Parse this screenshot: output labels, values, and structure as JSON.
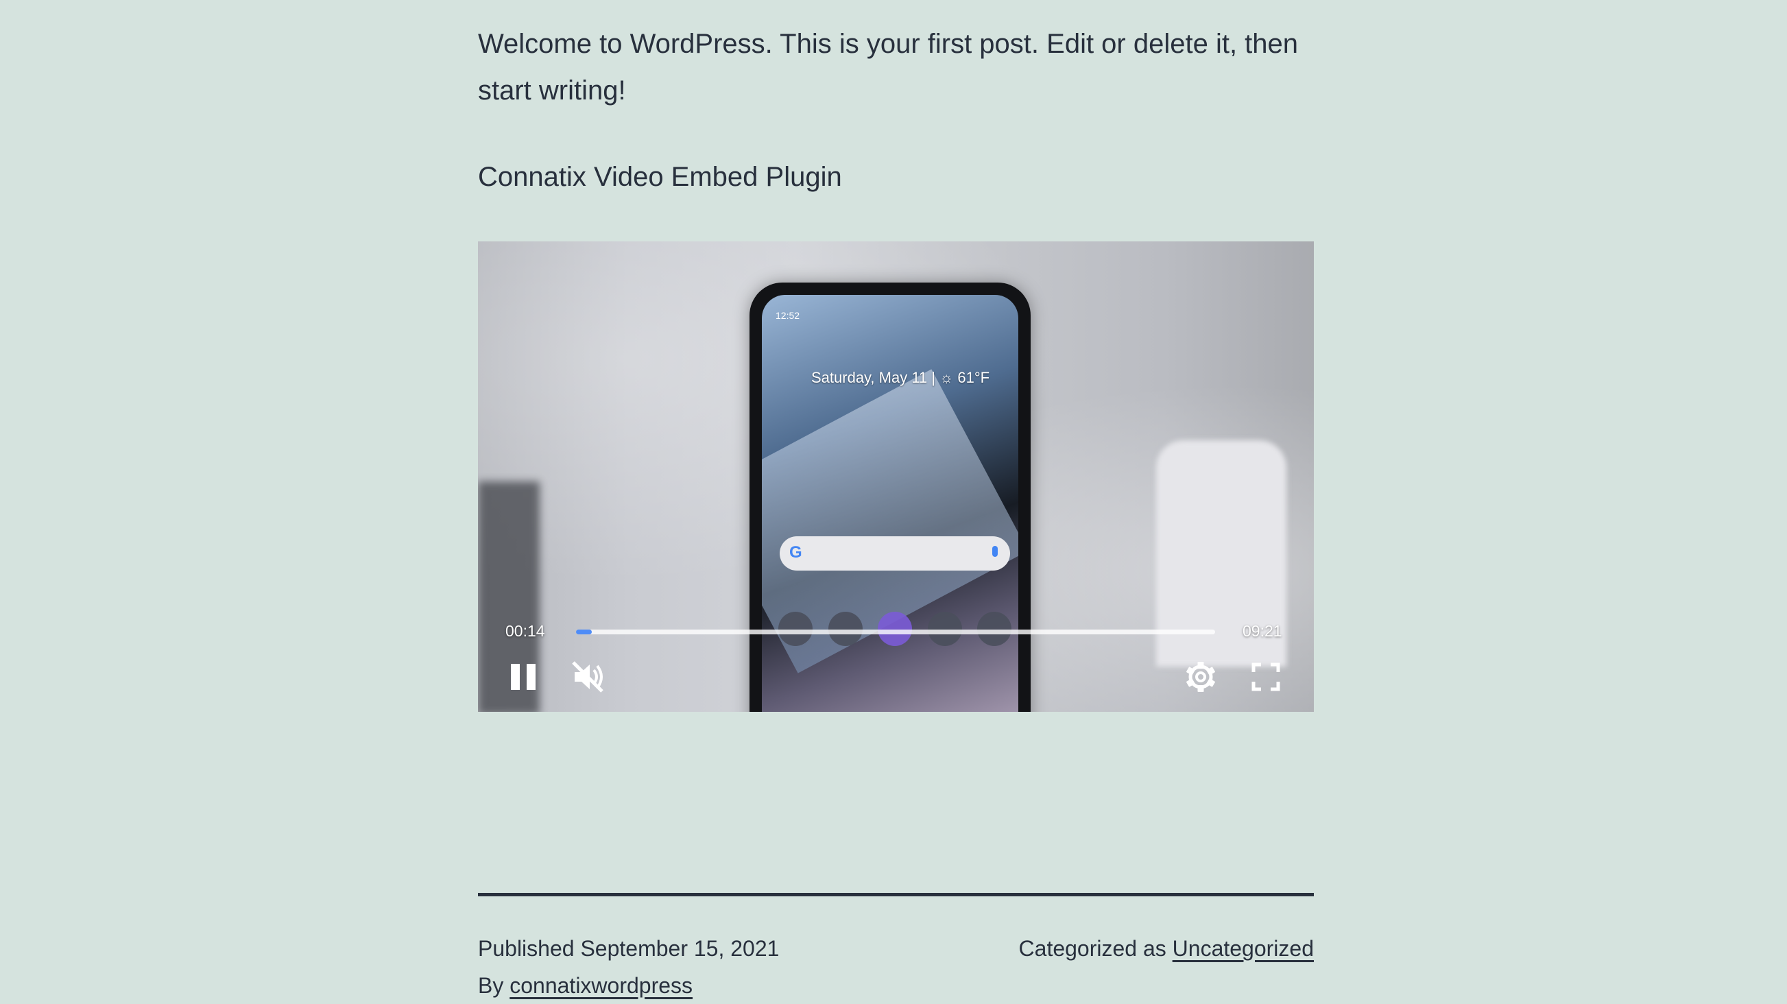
{
  "post": {
    "intro": "Welcome to WordPress. This is your first post. Edit or delete it, then start writing!",
    "plugin_title": "Connatix Video Embed Plugin"
  },
  "video": {
    "current_time": "00:14",
    "duration": "09:21",
    "progress_fraction": 0.025,
    "state": "playing",
    "muted": true,
    "screen_clock": "12:52",
    "screen_date": "Saturday, May 11 | ☼ 61°F",
    "search_logo": "G",
    "icons": [
      "pause-icon",
      "muted-speaker-icon",
      "gear-icon",
      "fullscreen-icon"
    ]
  },
  "footer": {
    "published_prefix": "Published",
    "published_date": "September 15, 2021",
    "categorized_prefix": "Categorized as",
    "category": "Uncategorized",
    "by_prefix": "By",
    "author": "connatixwordpress"
  },
  "colors": {
    "background": "#d5e3de",
    "text": "#28303d",
    "progress_accent": "#4f8cf7"
  }
}
